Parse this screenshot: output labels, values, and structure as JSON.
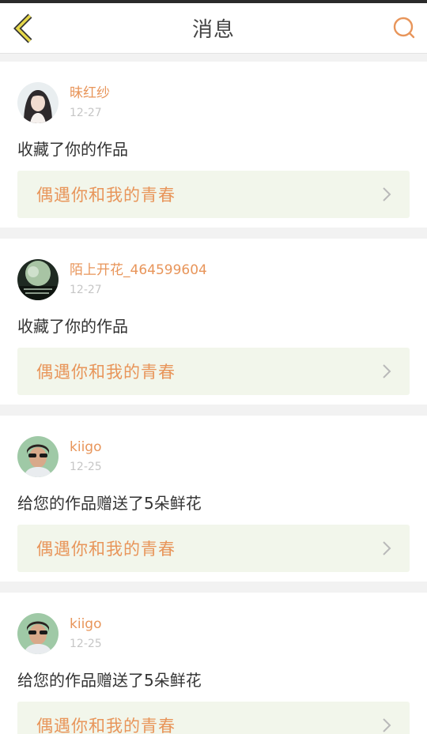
{
  "header": {
    "title": "消息",
    "back_icon": "chevron-left-icon",
    "search_icon": "search-icon",
    "accent_color": "#e8955a",
    "back_color": "#e6d84a"
  },
  "messages": [
    {
      "username": "昧红纱",
      "date": "12-27",
      "action": "收藏了你的作品",
      "work_title": "偶遇你和我的青春",
      "avatar": "avatar-woman"
    },
    {
      "username": "陌上开花_464599604",
      "date": "12-27",
      "action": "收藏了你的作品",
      "work_title": "偶遇你和我的青春",
      "avatar": "avatar-green"
    },
    {
      "username": "kiigo",
      "date": "12-25",
      "action": "给您的作品赠送了5朵鲜花",
      "work_title": "偶遇你和我的青春",
      "avatar": "avatar-man"
    },
    {
      "username": "kiigo",
      "date": "12-25",
      "action": "给您的作品赠送了5朵鲜花",
      "work_title": "偶遇你和我的青春",
      "avatar": "avatar-man"
    }
  ]
}
